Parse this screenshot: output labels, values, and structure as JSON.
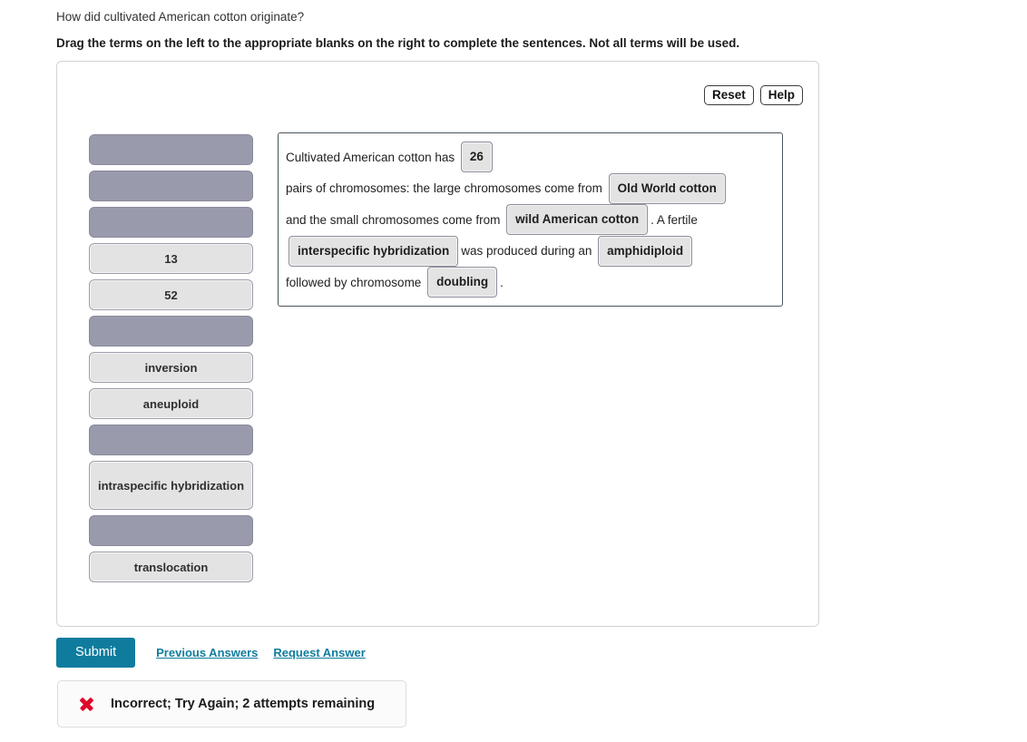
{
  "header": {
    "question": "How did cultivated American cotton originate?",
    "instruction": "Drag the terms on the left to the appropriate blanks on the right to complete the sentences. Not all terms will be used."
  },
  "toolbar": {
    "reset_label": "Reset",
    "help_label": "Help"
  },
  "term_bank": {
    "items": [
      {
        "label": "",
        "state": "used"
      },
      {
        "label": "",
        "state": "used"
      },
      {
        "label": "",
        "state": "used"
      },
      {
        "label": "13",
        "state": "available"
      },
      {
        "label": "52",
        "state": "available"
      },
      {
        "label": "",
        "state": "used"
      },
      {
        "label": "inversion",
        "state": "available"
      },
      {
        "label": "aneuploid",
        "state": "available"
      },
      {
        "label": "",
        "state": "used"
      },
      {
        "label": "intraspecific hybridization",
        "state": "available"
      },
      {
        "label": "",
        "state": "used"
      },
      {
        "label": "translocation",
        "state": "available"
      }
    ]
  },
  "sentence": {
    "parts": [
      {
        "type": "text",
        "value": "Cultivated American cotton has"
      },
      {
        "type": "token",
        "value": "26"
      },
      {
        "type": "text",
        "value": "pairs of chromosomes: the large chromosomes come from"
      },
      {
        "type": "token",
        "value": "Old World cotton"
      },
      {
        "type": "text",
        "value": "and the small chromosomes come from"
      },
      {
        "type": "token",
        "value": "wild American cotton"
      },
      {
        "type": "text",
        "value": ". A fertile"
      },
      {
        "type": "token",
        "value": "interspecific hybridization"
      },
      {
        "type": "text",
        "value": "was produced during an"
      },
      {
        "type": "token",
        "value": "amphidiploid"
      },
      {
        "type": "text",
        "value": "followed by chromosome"
      },
      {
        "type": "token",
        "value": "doubling"
      },
      {
        "type": "text",
        "value": "."
      }
    ]
  },
  "actions": {
    "submit_label": "Submit",
    "previous_answers_label": "Previous Answers",
    "request_answer_label": "Request Answer"
  },
  "feedback": {
    "icon": "x-mark-icon",
    "message": "Incorrect; Try Again; 2 attempts remaining",
    "color": "#e0052b"
  },
  "colors": {
    "accent": "#0f7c9e",
    "token_fill": "#e3e3e3",
    "used_term_fill": "#9a9aad",
    "sentence_border": "#4a545c"
  }
}
